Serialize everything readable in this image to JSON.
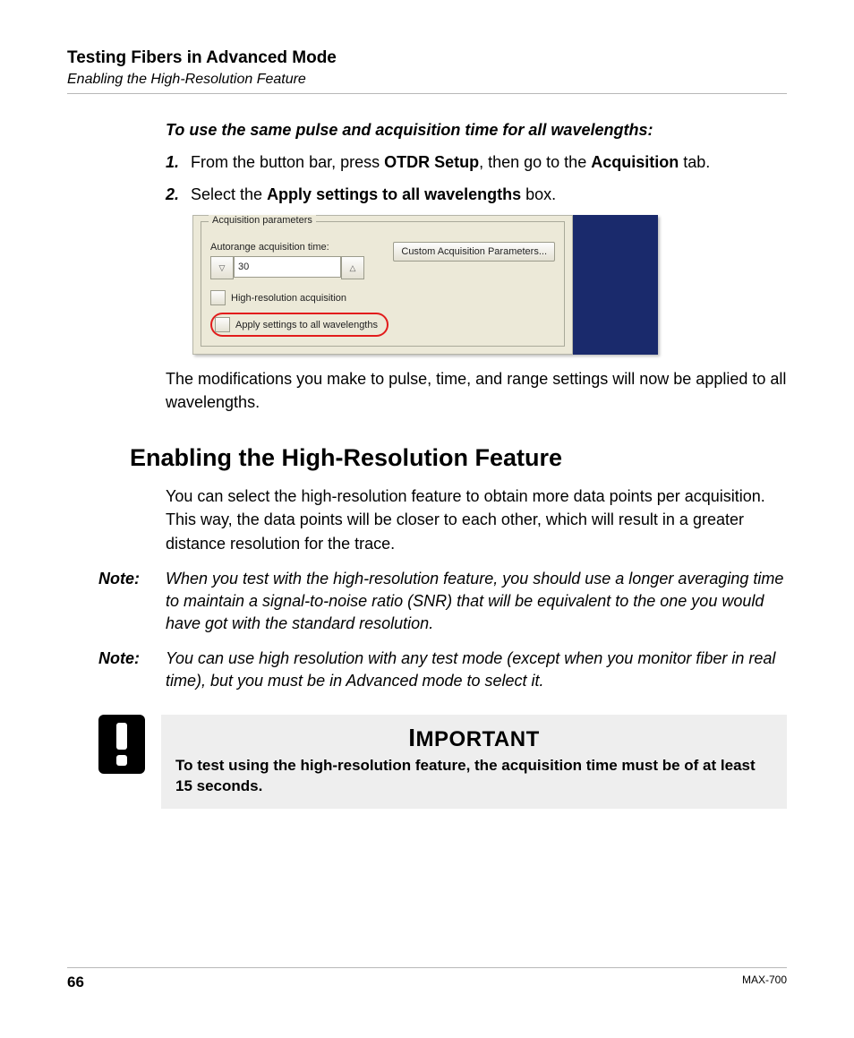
{
  "header": {
    "chapter": "Testing Fibers in Advanced Mode",
    "section": "Enabling the High-Resolution Feature"
  },
  "instructions": {
    "heading": "To use the same pulse and acquisition time for all wavelengths:",
    "step1_num": "1.",
    "step1_pre": "From the button bar, press ",
    "step1_b1": "OTDR Setup",
    "step1_mid": ", then go to the ",
    "step1_b2": "Acquisition",
    "step1_post": " tab.",
    "step2_num": "2.",
    "step2_pre": "Select the ",
    "step2_b1": "Apply settings to all wavelengths",
    "step2_post": " box."
  },
  "ui_figure": {
    "groupbox_title": "Acquisition parameters",
    "autorange_label": "Autorange acquisition time:",
    "autorange_value": "30",
    "spinner_down_glyph": "▽",
    "spinner_up_glyph": "△",
    "custom_button": "Custom Acquisition Parameters...",
    "checkbox_highres": "High-resolution acquisition",
    "checkbox_apply_all": "Apply settings to all wavelengths"
  },
  "post_figure_paragraph": "The modifications you make to pulse, time, and range settings will now be applied to all wavelengths.",
  "section": {
    "heading": "Enabling the High-Resolution Feature",
    "intro": "You can select the high-resolution feature to obtain more data points per acquisition. This way, the data points will be closer to each other, which will result in a greater distance resolution for the trace."
  },
  "notes": {
    "label": "Note:",
    "note1": "When you test with the high-resolution feature, you should use a longer averaging time to maintain a signal-to-noise ratio (SNR) that will be equivalent to the one you would have got with the standard resolution.",
    "note2": "You can use high resolution with any test mode (except when you monitor fiber in real time), but you must be in Advanced mode to select it."
  },
  "important": {
    "title_first": "I",
    "title_rest": "MPORTANT",
    "body": "To test using the high-resolution feature, the acquisition time must be of at least 15 seconds."
  },
  "footer": {
    "page_number": "66",
    "doc_id": "MAX-700"
  }
}
